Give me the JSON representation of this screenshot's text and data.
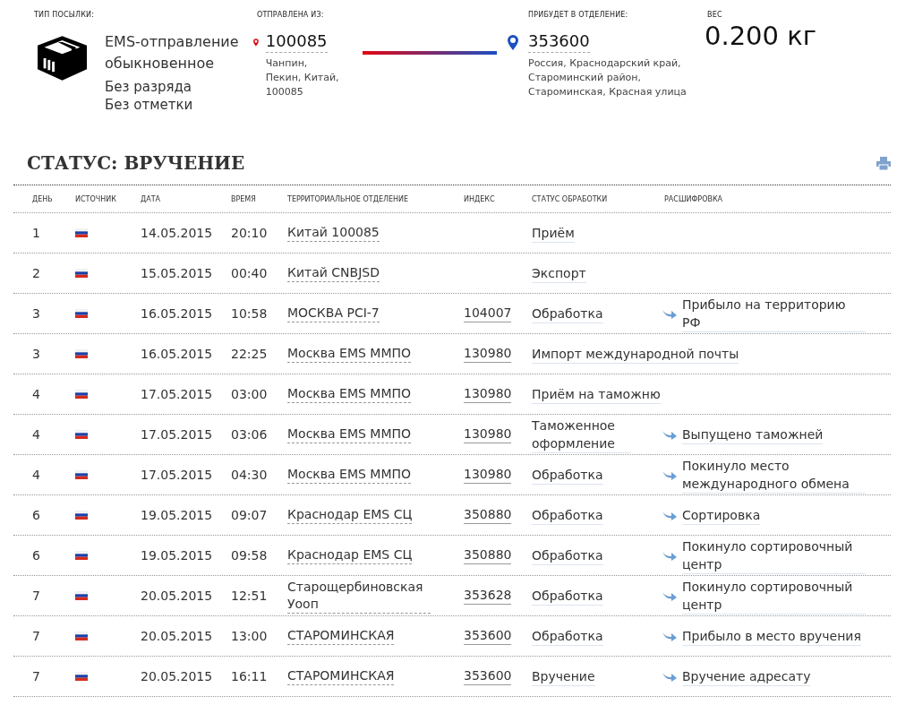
{
  "parcel": {
    "type_label": "ТИП ПОСЫЛКИ:",
    "type_name": "EMS-отправление обыкновенное",
    "rank": "Без разряда",
    "mark": "Без отметки"
  },
  "origin": {
    "label": "ОТПРАВЛЕНА ИЗ:",
    "index": "100085",
    "address": "Чанпин, Пекин, Китай, 100085"
  },
  "destination": {
    "label": "ПРИБУДЕТ В ОТДЕЛЕНИЕ:",
    "index": "353600",
    "address": "Россия, Краснодарский край, Староминский район, Староминская, Красная улица"
  },
  "weight": {
    "label": "ВЕС",
    "value": "0.200 кг"
  },
  "status_title": "СТАТУС: ВРУЧЕНИЕ",
  "table": {
    "columns": [
      "ДЕНЬ",
      "ИСТОЧНИК",
      "ДАТА",
      "ВРЕМЯ",
      "ТЕРРИТОРИАЛЬНОЕ ОТДЕЛЕНИЕ",
      "ИНДЕКС",
      "СТАТУС ОБРАБОТКИ",
      "РАСШИФРОВКА"
    ],
    "rows": [
      {
        "day": "1",
        "date": "14.05.2015",
        "time": "20:10",
        "office": "Китай 100085",
        "status": "Приём"
      },
      {
        "day": "2",
        "date": "15.05.2015",
        "time": "00:40",
        "office": "Китай CNBJSD",
        "status": "Экспорт"
      },
      {
        "day": "3",
        "date": "16.05.2015",
        "time": "10:58",
        "office": "МОСКВА PCI-7",
        "index": "104007",
        "status": "Обработка",
        "decoding": "Прибыло на территорию РФ"
      },
      {
        "day": "3",
        "date": "16.05.2015",
        "time": "22:25",
        "office": "Москва EMS ММПО",
        "index": "130980",
        "status": "Импорт международной почты"
      },
      {
        "day": "4",
        "date": "17.05.2015",
        "time": "03:00",
        "office": "Москва EMS ММПО",
        "index": "130980",
        "status": "Приём на таможню"
      },
      {
        "day": "4",
        "date": "17.05.2015",
        "time": "03:06",
        "office": "Москва EMS ММПО",
        "index": "130980",
        "status": "Таможенное оформление",
        "decoding": "Выпущено таможней"
      },
      {
        "day": "4",
        "date": "17.05.2015",
        "time": "04:30",
        "office": "Москва EMS ММПО",
        "index": "130980",
        "status": "Обработка",
        "decoding": "Покинуло место международного обмена"
      },
      {
        "day": "6",
        "date": "19.05.2015",
        "time": "09:07",
        "office": "Краснодар EMS СЦ",
        "index": "350880",
        "status": "Обработка",
        "decoding": "Сортировка"
      },
      {
        "day": "6",
        "date": "19.05.2015",
        "time": "09:58",
        "office": "Краснодар EMS СЦ",
        "index": "350880",
        "status": "Обработка",
        "decoding": "Покинуло сортировочный центр"
      },
      {
        "day": "7",
        "date": "20.05.2015",
        "time": "12:51",
        "office": "Старощербиновская Уооп",
        "index": "353628",
        "status": "Обработка",
        "decoding": "Покинуло сортировочный центр"
      },
      {
        "day": "7",
        "date": "20.05.2015",
        "time": "13:00",
        "office": "СТАРОМИНСКАЯ",
        "index": "353600",
        "status": "Обработка",
        "decoding": "Прибыло в место вручения"
      },
      {
        "day": "7",
        "date": "20.05.2015",
        "time": "16:11",
        "office": "СТАРОМИНСКАЯ",
        "index": "353600",
        "status": "Вручение",
        "decoding": "Вручение адресату"
      }
    ]
  }
}
